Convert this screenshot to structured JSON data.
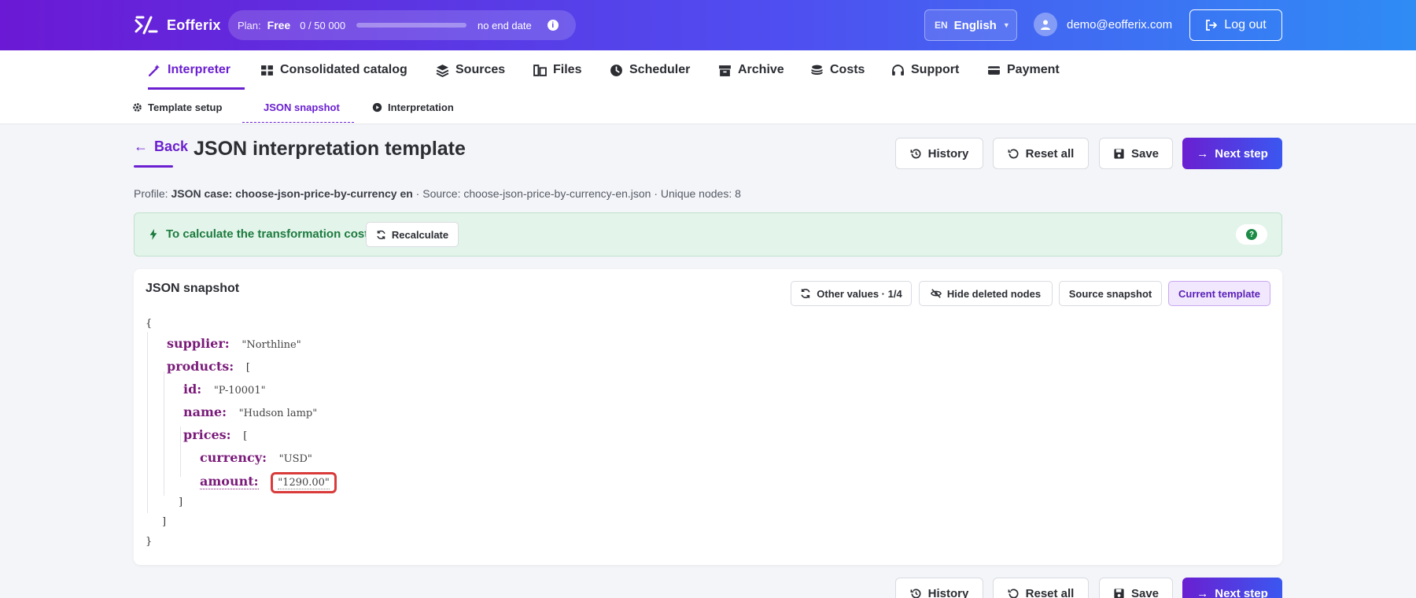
{
  "app": {
    "name": "Eofferix"
  },
  "plan": {
    "label": "Plan:",
    "tier": "Free",
    "usage": "0  /  50 000",
    "usage_fraction": 0.0,
    "end": "no end date"
  },
  "language": {
    "code": "EN",
    "name": "English"
  },
  "user": {
    "email": "demo@eofferix.com"
  },
  "logout_label": "Log out",
  "main_nav": [
    {
      "label": "Interpreter",
      "icon": "wand-icon"
    },
    {
      "label": "Consolidated catalog",
      "icon": "tree-icon"
    },
    {
      "label": "Sources",
      "icon": "layers-icon"
    },
    {
      "label": "Files",
      "icon": "files-icon"
    },
    {
      "label": "Scheduler",
      "icon": "clock-icon"
    },
    {
      "label": "Archive",
      "icon": "archive-icon"
    },
    {
      "label": "Costs",
      "icon": "coins-icon"
    },
    {
      "label": "Support",
      "icon": "headset-icon"
    },
    {
      "label": "Payment",
      "icon": "card-icon"
    }
  ],
  "sub_nav": [
    {
      "label": "Template setup",
      "icon": "gear-icon"
    },
    {
      "label": "JSON snapshot",
      "icon": ""
    },
    {
      "label": "Interpretation",
      "icon": "play-icon"
    }
  ],
  "page": {
    "back_label": "Back",
    "title": "JSON interpretation template",
    "actions": {
      "history": "History",
      "reset": "Reset all",
      "save": "Save",
      "next": "Next step"
    },
    "profile": {
      "label": "Profile:",
      "name": "JSON case: choose-json-price-by-currency en",
      "rest": " · Source: choose-json-price-by-currency-en.json · Unique nodes: 8"
    }
  },
  "banner": {
    "text": "To calculate the transformation cost",
    "recalc": "Recalculate",
    "help": "?"
  },
  "snapshot": {
    "title": "JSON snapshot",
    "buttons": {
      "other": "Other values · 1/4",
      "hide": "Hide deleted nodes",
      "source": "Source snapshot",
      "current": "Current template"
    },
    "open_brace": "{",
    "close_brace": "}",
    "supplier_key": "supplier:",
    "supplier_val": "\"Northline\"",
    "products_key": "products:",
    "open_bracket": "[",
    "close_bracket": "]",
    "id_key": "id:",
    "id_val": "\"P-10001\"",
    "name_key": "name:",
    "name_val": "\"Hudson lamp\"",
    "prices_key": "prices:",
    "currency_key": "currency:",
    "currency_val": "\"USD\"",
    "amount_key": "amount:",
    "amount_val": "\"1290.00\""
  },
  "colors": {
    "accent": "#6a1fd1",
    "brand_gradient_start": "#6b19d4",
    "brand_gradient_end": "#2f8cf5",
    "success": "#1c7b3e",
    "highlight": "#d93b3b"
  }
}
